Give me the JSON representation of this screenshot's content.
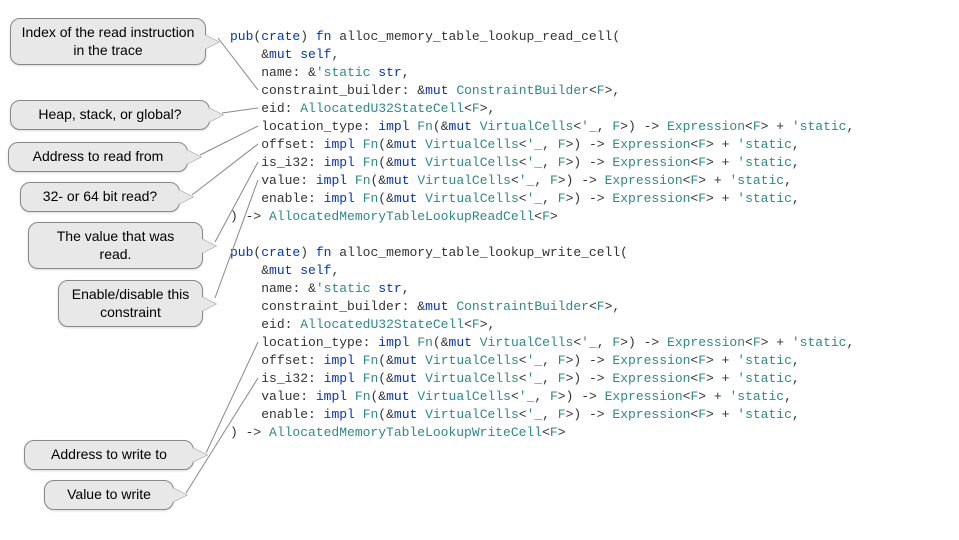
{
  "callouts": {
    "c1": "Index of the read instruction in the trace",
    "c2": "Heap, stack, or global?",
    "c3": "Address to read from",
    "c4": "32- or 64 bit read?",
    "c5": "The value that was read.",
    "c6": "Enable/disable this constraint",
    "c7": "Address to write to",
    "c8": "Value to write"
  },
  "code": {
    "fn1_name": "alloc_memory_table_lookup_read_cell",
    "fn2_name": "alloc_memory_table_lookup_write_cell",
    "ret1": "AllocatedMemoryTableLookupReadCell",
    "ret2": "AllocatedMemoryTableLookupWriteCell",
    "eid_ty": "AllocatedU32StateCell",
    "cb_ty": "ConstraintBuilder",
    "vc_ty": "VirtualCells",
    "expr_ty": "Expression",
    "str_ty": "str",
    "generic": "F",
    "lt": "'static",
    "anon_lt": "'_",
    "pub_crate": "pub",
    "crate": "crate",
    "fn": "fn",
    "impl": "impl",
    "Fn": "Fn",
    "mut": "mut",
    "params": {
      "self": "&mut self",
      "name": "name",
      "cb": "constraint_builder",
      "eid": "eid",
      "loc": "location_type",
      "off": "offset",
      "i32": "is_i32",
      "val": "value",
      "en": "enable"
    }
  }
}
